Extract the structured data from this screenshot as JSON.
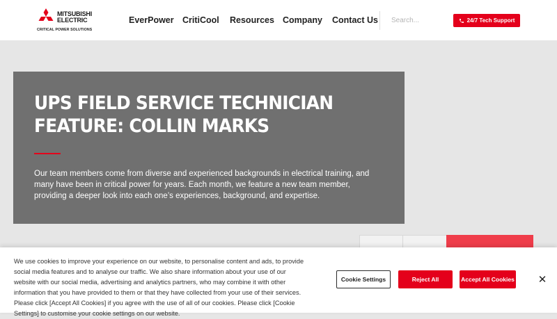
{
  "header": {
    "logo": {
      "line1": "MITSUBISHI",
      "line2": "ELECTRIC",
      "sub": "CRITICAL POWER SOLUTIONS",
      "brand_color": "#e4001b"
    },
    "nav": [
      "EverPower",
      "CritiCool",
      "Resources",
      "Company",
      "Contact Us"
    ],
    "search": {
      "placeholder": "Search..."
    },
    "support_button": {
      "label": "24/7 Tech Support",
      "icon": "phone-icon"
    }
  },
  "hero": {
    "title": "UPS Field Service Technician Feature: Collin Marks",
    "description": "Our team members come from diverse and experienced backgrounds in electrical training, and many have been in critical power for years. Each month, we feature a new team member, providing a deeper look into each one’s experiences, background, and expertise."
  },
  "cookie_banner": {
    "text": "We use cookies to improve your experience on our website, to personalise content and ads, to provide social media features and to analyse our traffic. We also share information about your use of our website with our social media, advertising and analytics partners, who may combine it with other information that you have provided to them or that they have collected from your use of their services. Please click [Accept All Cookies] if you agree with the use of all of our cookies. Please click [Cookie Settings] to customise your cookie settings on our website.",
    "settings_label": "Cookie Settings",
    "reject_label": "Reject All",
    "accept_label": "Accept All Cookies",
    "close_label": "✕"
  },
  "colors": {
    "accent": "#e4001b",
    "hero_bg": "#707070",
    "page_bg": "#e6e6e6"
  }
}
